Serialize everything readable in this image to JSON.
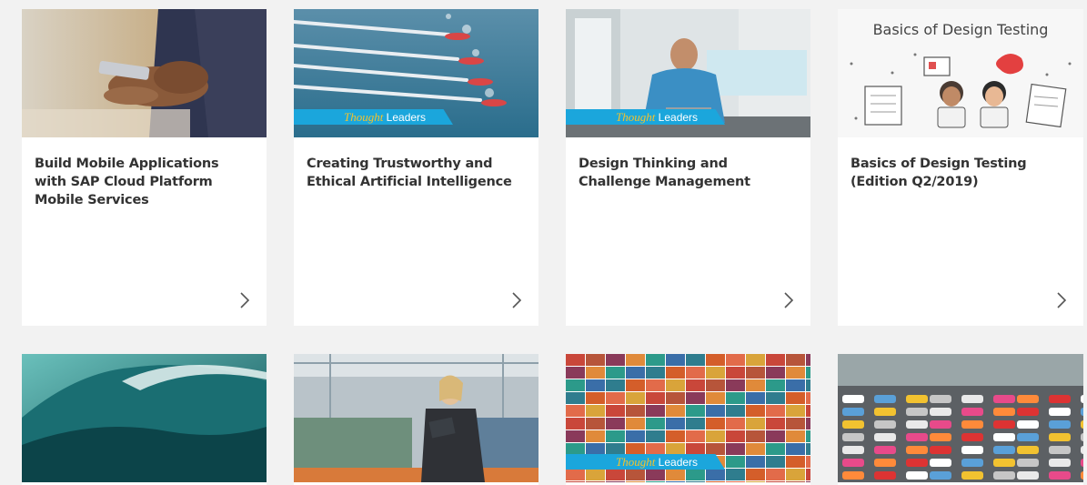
{
  "cards": [
    {
      "title": "Build Mobile Applications with SAP Cloud Platform Mobile Services",
      "image": "hands-holding-smartphone",
      "banner": null
    },
    {
      "title": "Creating Trustworthy and Ethical Artificial Intelligence",
      "image": "rowing-oars-in-water",
      "banner": {
        "word1": "Thought",
        "word2": " Leaders"
      }
    },
    {
      "title": "Design Thinking and Challenge Management",
      "image": "man-at-desk-with-laptop",
      "banner": {
        "word1": "Thought",
        "word2": " Leaders"
      }
    },
    {
      "title": "Basics of Design Testing (Edition Q2/2019)",
      "image": "design-testing-illustration",
      "image_text": "Basics of Design Testing",
      "banner": null
    },
    {
      "title": "",
      "image": "ocean-wave",
      "banner": null
    },
    {
      "title": "",
      "image": "woman-in-factory-with-tablet",
      "banner": null
    },
    {
      "title": "",
      "image": "stacked-shipping-containers",
      "banner": {
        "word1": "Thought",
        "word2": " Leaders"
      }
    },
    {
      "title": "",
      "image": "aerial-traffic-jam",
      "banner": null
    }
  ],
  "colors": {
    "page_bg": "#f2f2f2",
    "card_bg": "#ffffff",
    "title_text": "#333333",
    "banner_blue": "#1ba6dc",
    "banner_gold": "#f6c22b",
    "chevron": "#555555"
  }
}
